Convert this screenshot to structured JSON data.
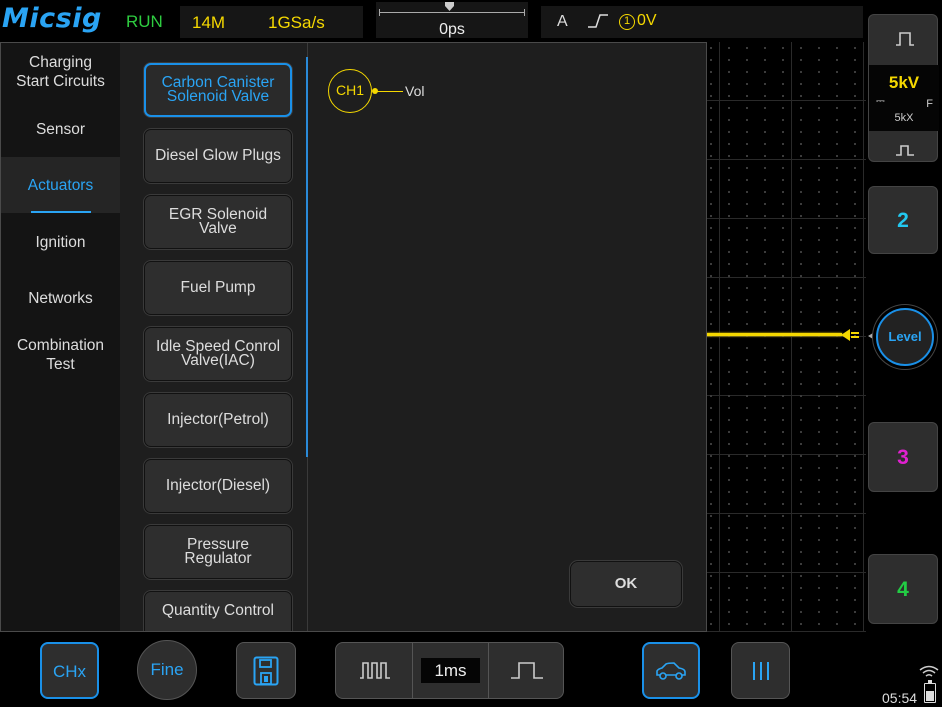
{
  "topbar": {
    "logo": "Micsig",
    "run_state": "RUN",
    "memory_depth": "14M",
    "sample_rate": "1GSa/s",
    "trigger_position": "0ps",
    "trigger_mode": "A",
    "trigger_edge_icon": "rising-edge-icon",
    "trigger_source_num": "1",
    "trigger_level": "0V"
  },
  "colors": {
    "accent": "#2aa4f4",
    "ch1": "#f5d800",
    "ch2": "#22c8f0",
    "ch3": "#e020d0",
    "ch4": "#22cc44",
    "run": "#2ecc40"
  },
  "right_panel": {
    "ch1_volts": "5kV",
    "ch1_coupling": "⎓",
    "ch1_bandwidth": "F",
    "ch1_probe": "5kX",
    "ch2_label": "2",
    "level_label": "Level",
    "ch3_label": "3",
    "ch4_label": "4",
    "clock": "05:54"
  },
  "bottombar": {
    "chx_label": "CHx",
    "fine_label": "Fine",
    "timebase": "1ms"
  },
  "modal": {
    "categories": [
      {
        "label_line1": "Charging",
        "label_line2": "Start Circuits"
      },
      {
        "label": "Sensor"
      },
      {
        "label": "Actuators",
        "active": true
      },
      {
        "label": "Ignition"
      },
      {
        "label": "Networks"
      },
      {
        "label_line1": "Combination",
        "label_line2": "Test"
      }
    ],
    "items": [
      {
        "line1": "Carbon Canister",
        "line2": "Solenoid Valve",
        "active": true
      },
      {
        "line1": "Diesel Glow Plugs"
      },
      {
        "line1": "EGR Solenoid",
        "line2": "Valve"
      },
      {
        "line1": "Fuel Pump"
      },
      {
        "line1": "Idle Speed Conrol",
        "line2": "Valve(IAC)"
      },
      {
        "line1": "Injector(Petrol)"
      },
      {
        "line1": "Injector(Diesel)"
      },
      {
        "line1": "Pressure",
        "line2": "Regulator"
      },
      {
        "line1": "Quantity Control"
      }
    ],
    "diagram": {
      "channel": "CH1",
      "signal": "Vol"
    },
    "ok_label": "OK"
  }
}
